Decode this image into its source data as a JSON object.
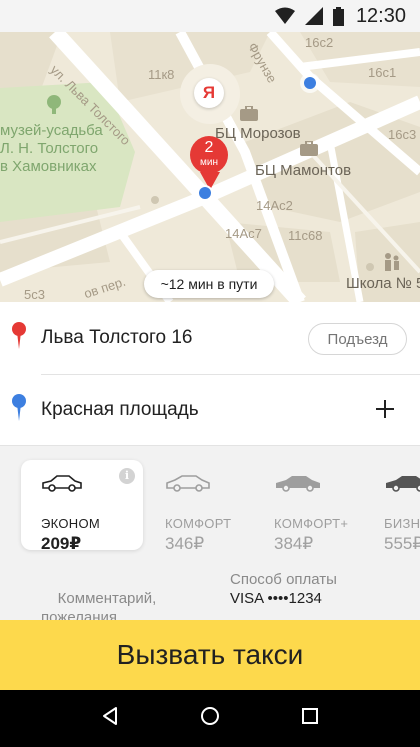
{
  "status_bar": {
    "time": "12:30"
  },
  "map": {
    "street_labels": [
      {
        "text": "ул. Льва Толстого"
      },
      {
        "text": "Фрунзе"
      },
      {
        "text": "ов пер."
      }
    ],
    "house_labels": [
      "16с2",
      "16с1",
      "11к8",
      "16с3",
      "14Ас2",
      "14Ас7",
      "11с68",
      "5с3",
      "Школа № 5"
    ],
    "poi_labels": [
      "музей-усадьба\nЛ. Н. Толстого\nв Хамовниках",
      "БЦ Морозов",
      "БЦ Мамонтов"
    ],
    "yandex_logo": "Я",
    "eta_pin": {
      "number": "2",
      "unit": "мин"
    },
    "trip_time": "~12 мин в пути"
  },
  "route": {
    "from": {
      "address": "Льва Толстого 16",
      "entrance_button": "Подъезд"
    },
    "to": {
      "address": "Красная площадь"
    }
  },
  "tariffs": [
    {
      "name": "ЭКОНОМ",
      "price": "209₽",
      "selected": true
    },
    {
      "name": "КОМФОРТ",
      "price": "346₽",
      "selected": false
    },
    {
      "name": "КОМФОРТ+",
      "price": "384₽",
      "selected": false
    },
    {
      "name": "БИЗН",
      "price": "555₽",
      "selected": false
    }
  ],
  "options": {
    "comment_label": "Комментарий,\nпожелания",
    "payment_label": "Способ оплаты",
    "payment_value": "VISA ••••1234"
  },
  "call_button": "Вызвать такси",
  "colors": {
    "accent_yellow": "#fdd94c",
    "pin_red": "#e53935",
    "pin_blue": "#3d7fe0"
  }
}
